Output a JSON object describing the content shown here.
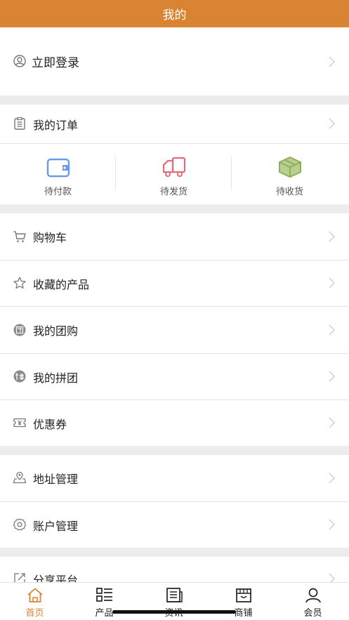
{
  "header": {
    "title": "我的"
  },
  "login": {
    "label": "立即登录"
  },
  "orders": {
    "label": "我的订单",
    "items": [
      {
        "label": "待付款",
        "icon": "wallet-icon",
        "color": "#6b9ae8"
      },
      {
        "label": "待发货",
        "icon": "truck-icon",
        "color": "#e36b7a"
      },
      {
        "label": "待收货",
        "icon": "package-icon",
        "color": "#8fb057"
      }
    ]
  },
  "menu": {
    "cart": "购物车",
    "favorites": "收藏的产品",
    "group_buy": "我的团购",
    "pin_group": "我的拼团",
    "coupons": "优惠券",
    "address": "地址管理",
    "account": "账户管理",
    "share": "分享平台"
  },
  "tabbar": {
    "active_color": "#d98432",
    "items": [
      {
        "label": "首页",
        "icon": "home-icon"
      },
      {
        "label": "产品",
        "icon": "list-icon"
      },
      {
        "label": "资讯",
        "icon": "news-icon"
      },
      {
        "label": "商铺",
        "icon": "store-icon"
      },
      {
        "label": "会员",
        "icon": "user-icon"
      }
    ]
  },
  "colors": {
    "accent": "#d98432",
    "background": "#ececec"
  }
}
